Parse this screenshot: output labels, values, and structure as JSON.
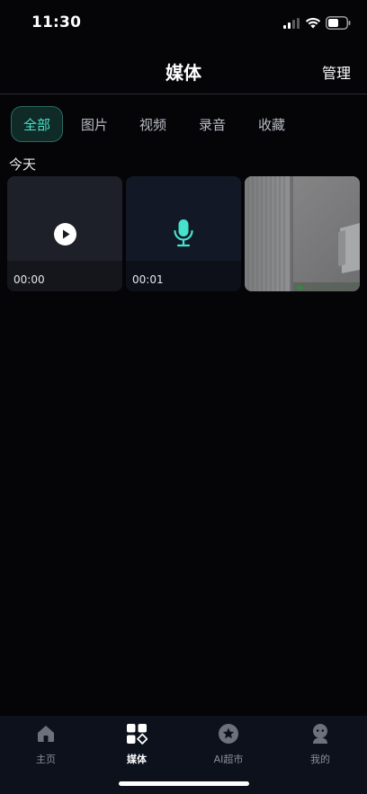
{
  "status_bar": {
    "time": "11:30"
  },
  "header": {
    "title": "媒体",
    "manage_label": "管理"
  },
  "tabs": [
    {
      "label": "全部",
      "active": true
    },
    {
      "label": "图片",
      "active": false
    },
    {
      "label": "视频",
      "active": false
    },
    {
      "label": "录音",
      "active": false
    },
    {
      "label": "收藏",
      "active": false
    }
  ],
  "section": {
    "title": "今天"
  },
  "media_items": [
    {
      "kind": "video",
      "duration": "00:00",
      "icon": "play-icon"
    },
    {
      "kind": "audio",
      "duration": "00:01",
      "icon": "microphone-icon"
    },
    {
      "kind": "photo"
    }
  ],
  "bottom_nav": [
    {
      "label": "主页",
      "icon": "home-icon",
      "active": false
    },
    {
      "label": "媒体",
      "icon": "media-grid-icon",
      "active": true
    },
    {
      "label": "AI超市",
      "icon": "star-badge-icon",
      "active": false
    },
    {
      "label": "我的",
      "icon": "profile-icon",
      "active": false
    }
  ],
  "colors": {
    "accent": "#46e2cc",
    "background": "#050507",
    "nav_background": "#0c111b"
  }
}
